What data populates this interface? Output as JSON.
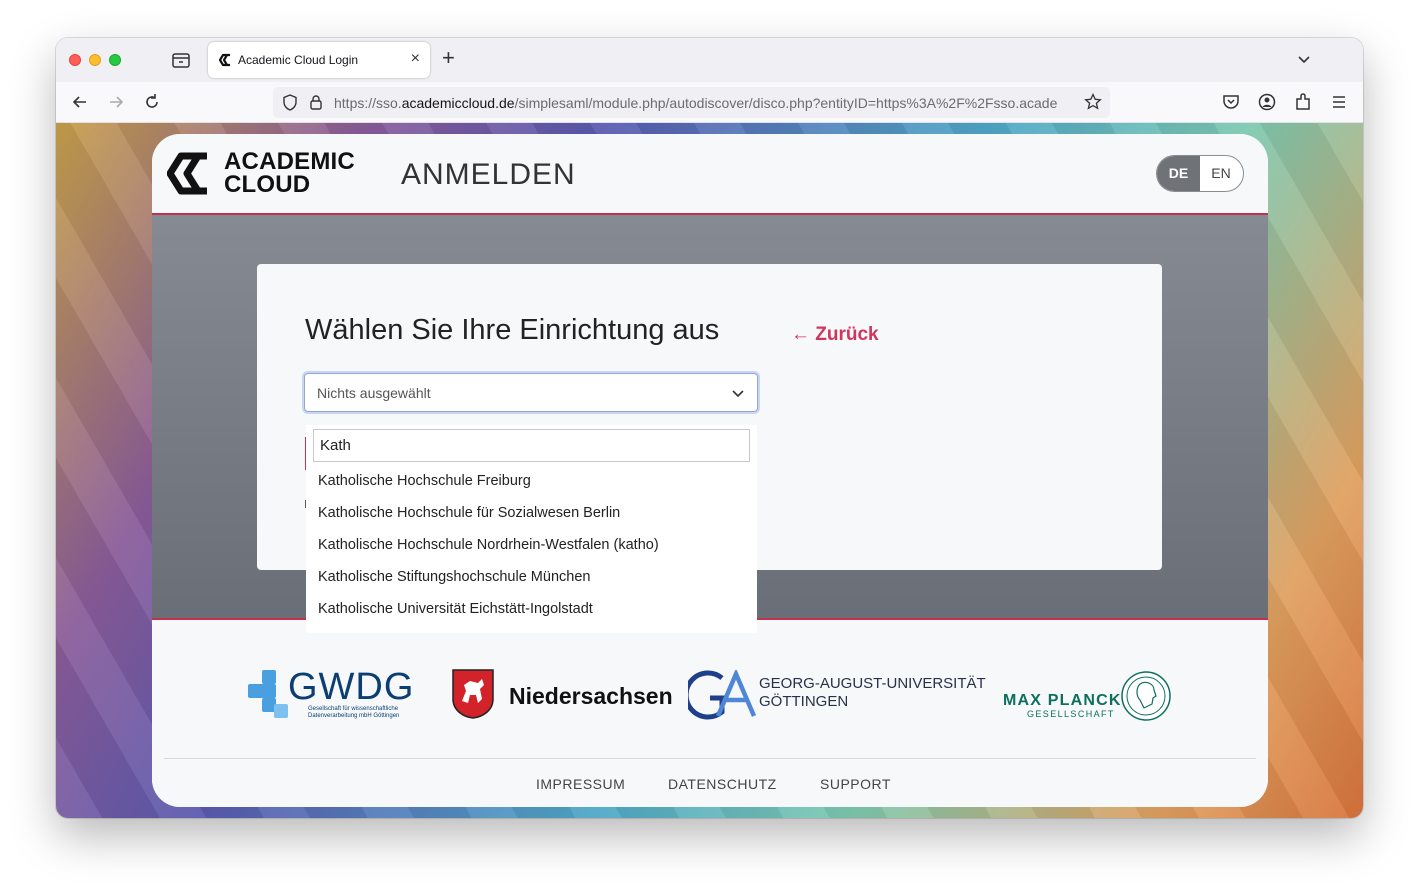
{
  "browser": {
    "tab_title": "Academic Cloud Login",
    "tab_close": "×",
    "new_tab": "+",
    "url_prefix": "https://sso.",
    "url_domain": "academiccloud.de",
    "url_path": "/simplesaml/module.php/autodiscover/disco.php?entityID=https%3A%2F%2Fsso.acade"
  },
  "header": {
    "logo_line1": "ACADEMIC",
    "logo_line2": "CLOUD",
    "page_title": "ANMELDEN",
    "lang_de": "DE",
    "lang_en": "EN"
  },
  "panel": {
    "title": "Wählen Sie Ihre Einrichtung aus",
    "back_link": "← Zurück",
    "select_value": "Nichts ausgewählt"
  },
  "dropdown": {
    "search_value": "Kath",
    "options": [
      "Katholische Hochschule Freiburg",
      "Katholische Hochschule für Sozialwesen Berlin",
      "Katholische Hochschule Nordrhein-Westfalen (katho)",
      "Katholische Stiftungshochschule München",
      "Katholische Universität Eichstätt-Ingolstadt"
    ]
  },
  "footer": {
    "partners": {
      "gwdg": "GWDG",
      "gwdg_sub": "Gesellschaft für wissenschaftliche Datenverarbeitung mbH Göttingen",
      "niedersachsen": "Niedersachsen",
      "uni_line1": "GEORG-AUGUST-UNIVERSITÄT",
      "uni_line2": "GÖTTINGEN",
      "mpg_line1": "MAX PLANCK",
      "mpg_line2": "GESELLSCHAFT"
    },
    "links": [
      "IMPRESSUM",
      "DATENSCHUTZ",
      "SUPPORT"
    ]
  },
  "colors": {
    "accent": "#c4314b",
    "link": "#d0365a",
    "gwdg_blue": "#0b3f73",
    "mpg_green": "#0d6f5e"
  }
}
